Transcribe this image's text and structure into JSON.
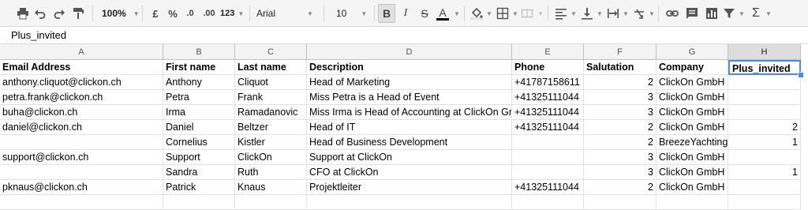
{
  "toolbar": {
    "zoom": "100%",
    "currency": "£",
    "percent": "%",
    "decrease_decimals": ".0",
    "increase_decimals": ".00",
    "more_formats": "123",
    "font_family": "Arial",
    "font_size": "10",
    "bold": "B",
    "italic": "I",
    "strikethrough": "S",
    "text_color": "A",
    "functions": "Σ"
  },
  "formula_bar": {
    "value": "Plus_invited"
  },
  "grid": {
    "column_headers": [
      "A",
      "B",
      "C",
      "D",
      "E",
      "F",
      "G",
      "H"
    ],
    "header_row": [
      "Email Address",
      "First name",
      "Last name",
      "Description",
      "Phone",
      "Salutation",
      "Company",
      "Plus_invited"
    ],
    "rows": [
      [
        "anthony.cliquot@clickon.ch",
        "Anthony",
        "Cliquot",
        "Head of Marketing",
        "+41787158611",
        "2",
        "ClickOn GmbH",
        ""
      ],
      [
        "petra.frank@clickon.ch",
        "Petra",
        "Frank",
        "Miss Petra is a Head of Event",
        "+41325111044",
        "3",
        "ClickOn GmbH",
        ""
      ],
      [
        "buha@clickon.ch",
        "Irma",
        "Ramadanovic",
        "Miss Irma is Head of Accounting at ClickOn Gmbh",
        "+41325111044",
        "3",
        "ClickOn GmbH",
        ""
      ],
      [
        "daniel@clickon.ch",
        "Daniel",
        "Beltzer",
        "Head of IT",
        "+41325111044",
        "2",
        "ClickOn GmbH",
        "2"
      ],
      [
        "",
        "Cornelius",
        "Kistler",
        "Head of Business Development",
        "",
        "2",
        "BreezeYachting",
        "1"
      ],
      [
        "support@clickon.ch",
        "Support",
        "ClickOn",
        "Support at ClickOn",
        "",
        "3",
        "ClickOn GmbH",
        ""
      ],
      [
        "",
        "Sandra",
        "Ruth",
        "CFO at ClickOn",
        "",
        "3",
        "ClickOn GmbH",
        "1"
      ],
      [
        "pknaus@clickon.ch",
        "Patrick",
        "Knaus",
        "Projektleiter",
        "+41325111044",
        "2",
        "ClickOn GmbH",
        ""
      ],
      [
        "",
        "",
        "",
        "",
        "",
        "",
        "",
        ""
      ]
    ]
  },
  "colors": {
    "selection": "#4a87ee",
    "header_bg": "#f3f3f3",
    "toolbar_bg": "#f5f5f5"
  }
}
